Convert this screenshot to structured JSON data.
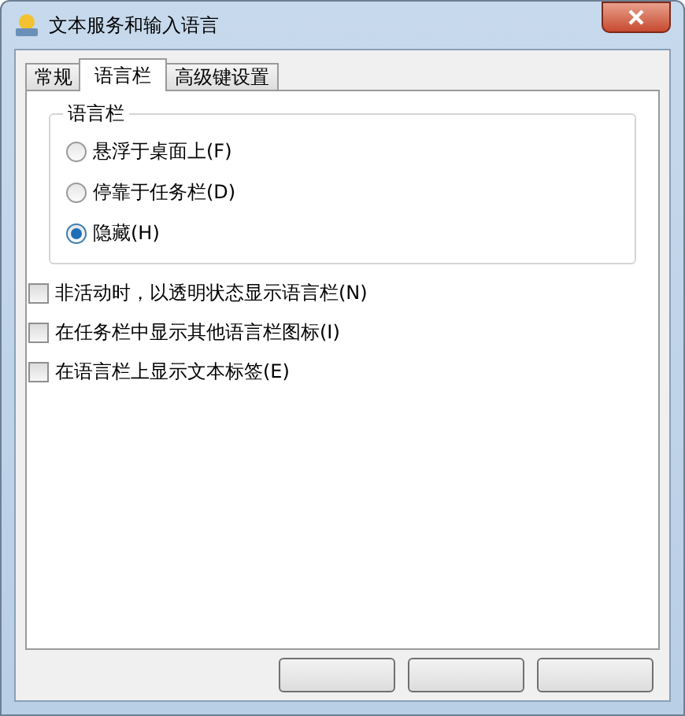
{
  "window": {
    "title": "文本服务和输入语言"
  },
  "tabs": [
    {
      "label": "常规",
      "selected": false
    },
    {
      "label": "语言栏",
      "selected": true
    },
    {
      "label": "高级键设置",
      "selected": false
    }
  ],
  "language_bar": {
    "title": "语言栏",
    "options": [
      {
        "label": "悬浮于桌面上(F)",
        "selected": false
      },
      {
        "label": "停靠于任务栏(D)",
        "selected": false
      },
      {
        "label": "隐藏(H)",
        "selected": true
      }
    ]
  },
  "checkboxes": [
    {
      "label": "非活动时，以透明状态显示语言栏(N)",
      "checked": false
    },
    {
      "label": "在任务栏中显示其他语言栏图标(I)",
      "checked": false
    },
    {
      "label": "在语言栏上显示文本标签(E)",
      "checked": false
    }
  ]
}
